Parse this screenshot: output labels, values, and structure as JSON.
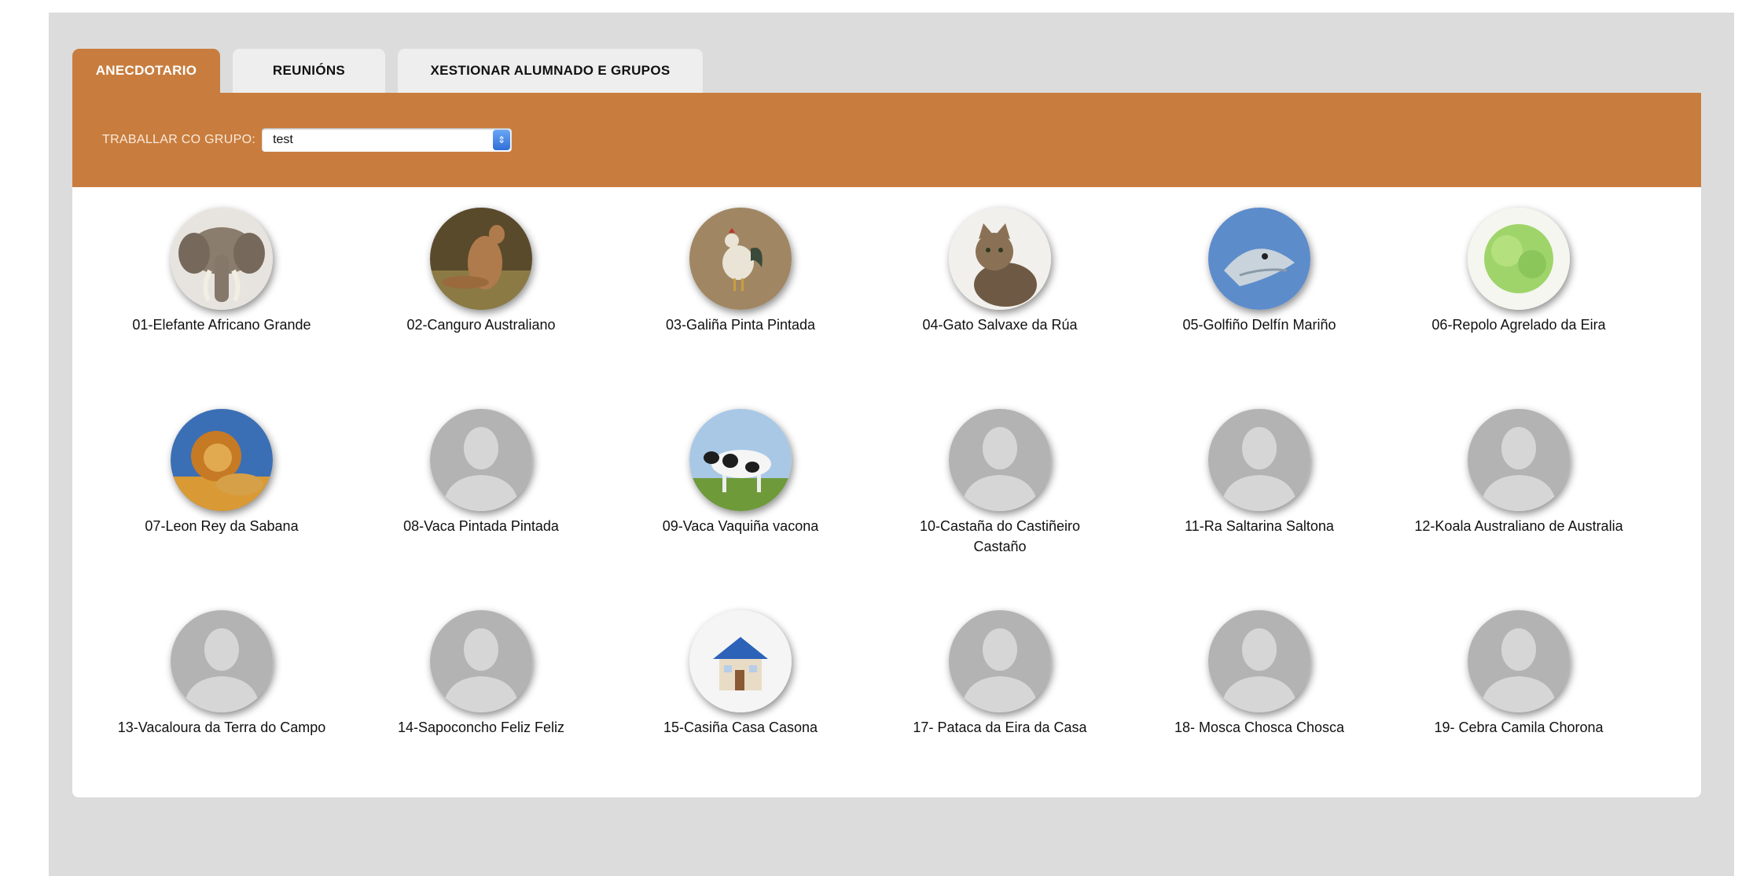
{
  "tabs": [
    {
      "label": "ANECDOTARIO",
      "active": true
    },
    {
      "label": "REUNIÓNS",
      "active": false
    },
    {
      "label": "XESTIONAR ALUMNADO E GRUPOS",
      "active": false
    }
  ],
  "group_selector": {
    "label": "TRABALLAR CO GRUPO:",
    "value": "test"
  },
  "colors": {
    "accent": "#c87d3e",
    "background": "#dcdcdc",
    "panel": "#ffffff",
    "placeholder": "#b3b3b3"
  },
  "students": [
    {
      "name": "01-Elefante Africano Grande",
      "avatar": "elephant-photo"
    },
    {
      "name": "02-Canguro Australiano",
      "avatar": "kangaroo-photo"
    },
    {
      "name": "03-Galiña Pinta Pintada",
      "avatar": "rooster-photo"
    },
    {
      "name": "04-Gato Salvaxe da Rúa",
      "avatar": "cat-photo"
    },
    {
      "name": "05-Golfiño Delfín Mariño",
      "avatar": "dolphin-photo"
    },
    {
      "name": "06-Repolo Agrelado da Eira",
      "avatar": "cabbage-photo"
    },
    {
      "name": "07-Leon Rey da Sabana",
      "avatar": "lion-photo"
    },
    {
      "name": "08-Vaca Pintada Pintada",
      "avatar": "default-user"
    },
    {
      "name": "09-Vaca Vaquiña vacona",
      "avatar": "cow-photo"
    },
    {
      "name": "10-Castaña do Castiñeiro Castaño",
      "avatar": "default-user"
    },
    {
      "name": "11-Ra Saltarina Saltona",
      "avatar": "default-user"
    },
    {
      "name": "12-Koala Australiano de Australia",
      "avatar": "default-user"
    },
    {
      "name": "13-Vacaloura da Terra do Campo",
      "avatar": "default-user"
    },
    {
      "name": "14-Sapoconcho Feliz Feliz",
      "avatar": "default-user"
    },
    {
      "name": "15-Casiña Casa Casona",
      "avatar": "house-photo"
    },
    {
      "name": "17- Pataca da Eira da Casa",
      "avatar": "default-user"
    },
    {
      "name": "18- Mosca Chosca Chosca",
      "avatar": "default-user"
    },
    {
      "name": "19- Cebra Camila Chorona",
      "avatar": "default-user"
    }
  ]
}
